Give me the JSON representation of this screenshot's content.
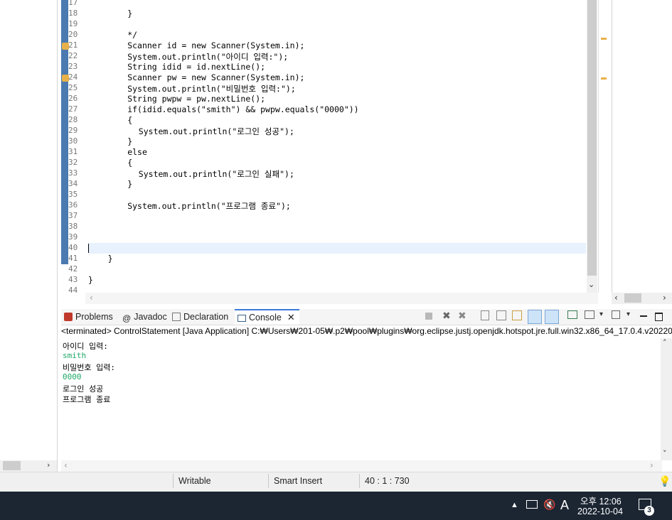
{
  "editor": {
    "lines": [
      {
        "no": "17",
        "code": ""
      },
      {
        "no": "18",
        "code": "}"
      },
      {
        "no": "19",
        "code": ""
      },
      {
        "no": "20",
        "code": "*/"
      },
      {
        "no": "21",
        "code": "Scanner id = new Scanner(System.in);"
      },
      {
        "no": "22",
        "code": "System.out.println(\"아이디 입력:\");"
      },
      {
        "no": "23",
        "code": "String idid = id.nextLine();"
      },
      {
        "no": "24",
        "code": "Scanner pw = new Scanner(System.in);"
      },
      {
        "no": "25",
        "code": "System.out.println(\"비밀번호 입력:\");"
      },
      {
        "no": "26",
        "code": "String pwpw = pw.nextLine();"
      },
      {
        "no": "27",
        "code": "if(idid.equals(\"smith\") && pwpw.equals(\"0000\"))"
      },
      {
        "no": "28",
        "code": "{"
      },
      {
        "no": "29",
        "code": "System.out.println(\"로그인 성공\");"
      },
      {
        "no": "30",
        "code": "}"
      },
      {
        "no": "31",
        "code": "else"
      },
      {
        "no": "32",
        "code": "{"
      },
      {
        "no": "33",
        "code": "System.out.println(\"로그인 실패\");"
      },
      {
        "no": "34",
        "code": "}"
      },
      {
        "no": "35",
        "code": ""
      },
      {
        "no": "36",
        "code": "System.out.println(\"프로그램 종료\");"
      },
      {
        "no": "37",
        "code": ""
      },
      {
        "no": "38",
        "code": ""
      },
      {
        "no": "39",
        "code": ""
      },
      {
        "no": "40",
        "code": ""
      },
      {
        "no": "41",
        "code": "}"
      },
      {
        "no": "42",
        "code": ""
      },
      {
        "no": "43",
        "code": "}"
      },
      {
        "no": "44",
        "code": ""
      }
    ]
  },
  "views": {
    "tabs": [
      {
        "label": "Problems"
      },
      {
        "label": "Javadoc"
      },
      {
        "label": "Declaration"
      },
      {
        "label": "Console"
      }
    ]
  },
  "console": {
    "header": "<terminated> ControlStatement [Java Application] C:₩Users₩201-05₩.p2₩pool₩plugins₩org.eclipse.justj.openjdk.hotspot.jre.full.win32.x86_64_17.0.4.v20220",
    "output": [
      {
        "text": "아이디 입력:",
        "kind": "out"
      },
      {
        "text": "smith",
        "kind": "in"
      },
      {
        "text": "비밀번호 입력:",
        "kind": "out"
      },
      {
        "text": "0000",
        "kind": "in"
      },
      {
        "text": "로그인 성공",
        "kind": "out"
      },
      {
        "text": "프로그램 종료",
        "kind": "out"
      }
    ]
  },
  "status": {
    "writable": "Writable",
    "insert_mode": "Smart Insert",
    "position": "40 : 1 : 730"
  },
  "taskbar": {
    "ime": "A",
    "time": "오후 12:06",
    "date": "2022-10-04",
    "notification_count": "3"
  },
  "colors": {
    "keyword": "#7f0055",
    "string": "#2a00ff",
    "field": "#0000c0",
    "console_input": "#1ea867",
    "taskbar": "#1c2633"
  }
}
